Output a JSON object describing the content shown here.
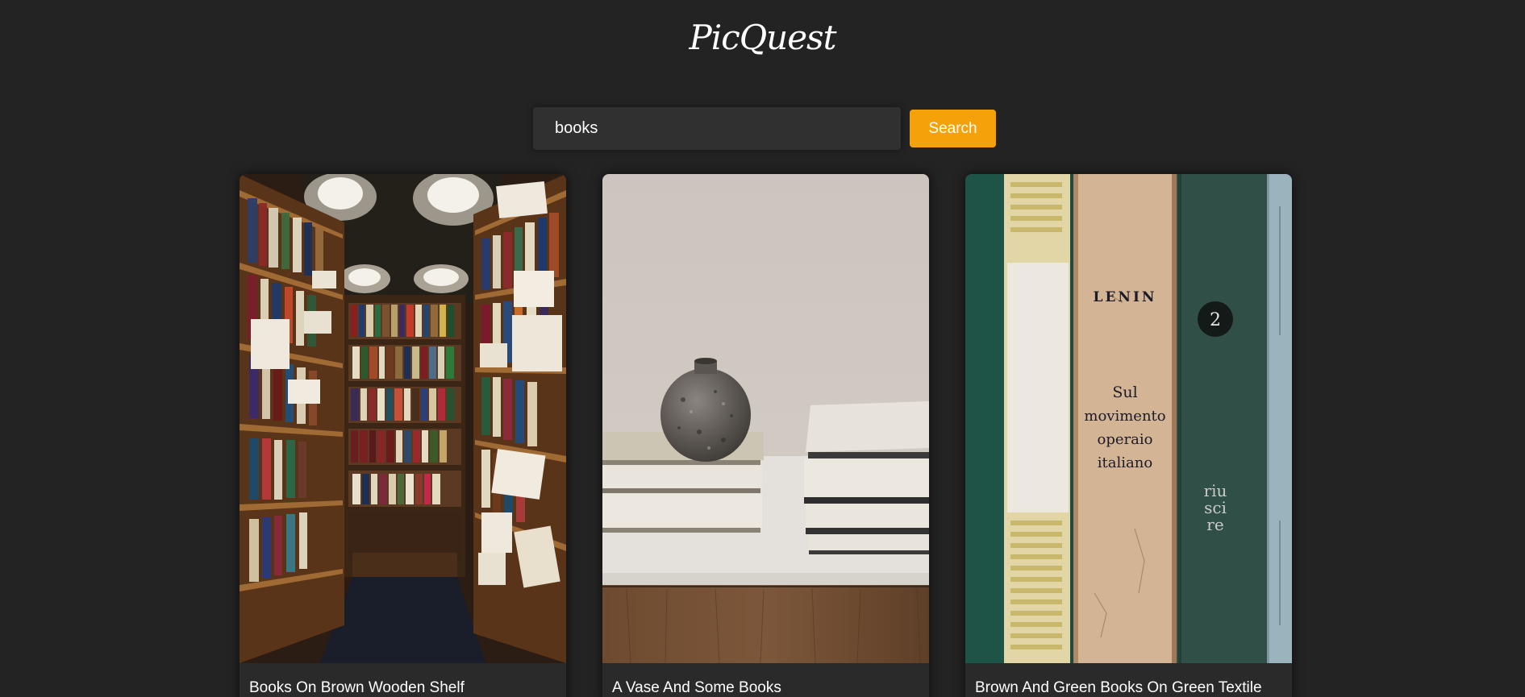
{
  "app": {
    "logo": "PicQuest"
  },
  "search": {
    "value": "books",
    "button_label": "Search"
  },
  "results": [
    {
      "title": "Books On Brown Wooden Shelf",
      "image": "library-aisle-photo"
    },
    {
      "title": "A Vase And Some Books",
      "image": "vase-books-photo"
    },
    {
      "title": "Brown And Green Books On Green Textile",
      "image": "book-spines-photo",
      "spine_text": {
        "author": "LENIN",
        "title_lines": [
          "Sul",
          "movimento",
          "operaio",
          "italiano"
        ],
        "volume": "2",
        "side_lines": [
          "riu",
          "sci",
          "re"
        ]
      }
    }
  ]
}
